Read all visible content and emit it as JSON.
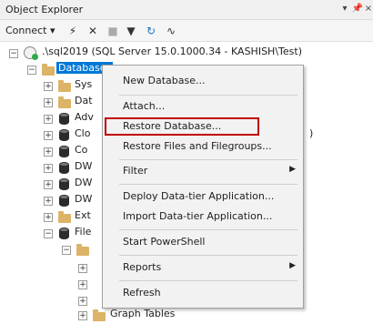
{
  "panel": {
    "title": "Object Explorer",
    "pin": "📌",
    "close": "×"
  },
  "toolbar": {
    "connect_label": "Connect ▾"
  },
  "tree": {
    "server": ".\\sql2019 (SQL Server 15.0.1000.34 - KASHISH\\Test)",
    "databases": "Databases",
    "nodes": [
      "Sys",
      "Dat",
      "Adv",
      "Clo",
      "Co",
      "DW",
      "DW",
      "DW",
      "Ext",
      "File"
    ],
    "graph_tables": "Graph Tables",
    "right_paren": ")"
  },
  "context_menu": {
    "items": [
      "New Database...",
      "Attach...",
      "Restore Database...",
      "Restore Files and Filegroups...",
      "Filter",
      "Deploy Data-tier Application...",
      "Import Data-tier Application...",
      "Start PowerShell",
      "Reports",
      "Refresh"
    ],
    "submenu_arrow": "▶"
  },
  "colors": {
    "selection": "#0078d7",
    "highlight_box": "#c00000"
  }
}
